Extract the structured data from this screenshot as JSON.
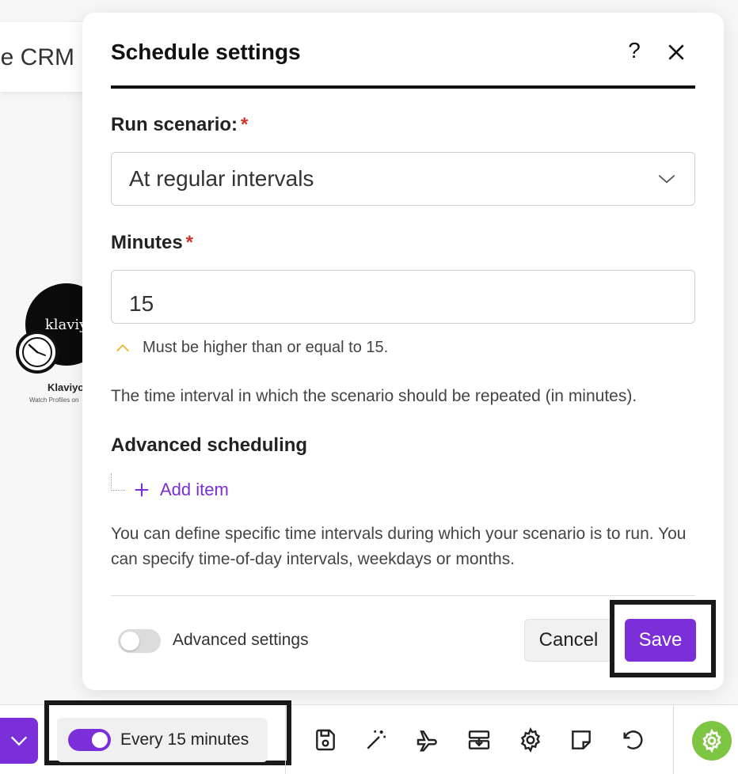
{
  "background": {
    "crm_tab_text": "le CRM",
    "module": {
      "logo_text": "klaviyo",
      "title": "Klaviyo",
      "subtitle": "Watch Profiles on"
    }
  },
  "modal": {
    "title": "Schedule settings",
    "help_label": "?",
    "run_scenario_label": "Run scenario:",
    "run_scenario_value": "At regular intervals",
    "required_mark": "*",
    "minutes_label": "Minutes",
    "minutes_value": "15",
    "minutes_hint": "Must be higher than or equal to 15.",
    "minutes_help": "The time interval in which the scenario should be repeated (in minutes).",
    "advanced_scheduling_title": "Advanced scheduling",
    "add_item_label": "Add item",
    "advanced_scheduling_help": "You can define specific time intervals during which your scenario is to run. You can specify time-of-day intervals, weekdays or months.",
    "advanced_settings_label": "Advanced settings",
    "cancel_label": "Cancel",
    "save_label": "Save"
  },
  "toolbar": {
    "schedule_label": "Every 15 minutes",
    "icons": [
      "save-icon",
      "magic-wand-icon",
      "airplane-icon",
      "import-export-icon",
      "gear-icon",
      "note-icon",
      "undo-icon"
    ]
  },
  "colors": {
    "accent": "#7b2fd8",
    "required": "#d0342c",
    "hint_chevron": "#e5b93a",
    "status_green": "#7ec544"
  }
}
